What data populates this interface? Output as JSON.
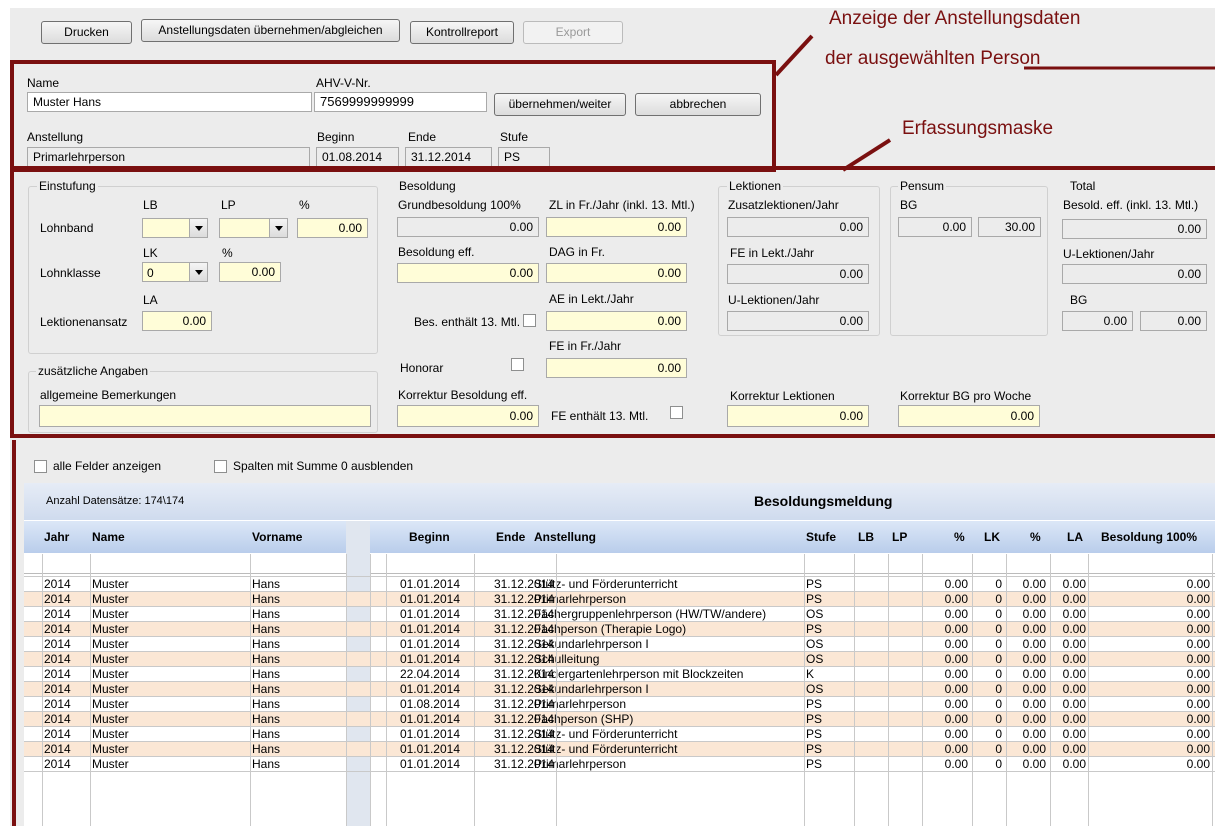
{
  "toolbar": {
    "print": "Drucken",
    "sync": "Anstellungsdaten übernehmen/abgleichen",
    "report": "Kontrollreport",
    "export": "Export"
  },
  "annotations": {
    "a1": "Anzeige der Anstellungsdaten",
    "a2": "der ausgewählten Person",
    "a3": "Erfassungsmaske"
  },
  "person": {
    "name_label": "Name",
    "name": "Muster Hans",
    "ahv_label": "AHV-V-Nr.",
    "ahv": "7569999999999",
    "accept_button": "übernehmen/weiter",
    "cancel_button": "abbrechen",
    "anstellung_label": "Anstellung",
    "anstellung": "Primarlehrperson",
    "beginn_label": "Beginn",
    "beginn": "01.08.2014",
    "ende_label": "Ende",
    "ende": "31.12.2014",
    "stufe_label": "Stufe",
    "stufe": "PS"
  },
  "einstufung": {
    "title": "Einstufung",
    "lb": "LB",
    "lp": "LP",
    "pct": "%",
    "lohnband": "Lohnband",
    "lohnband_pct": "0.00",
    "lk": "LK",
    "pct2": "%",
    "lohnklasse": "Lohnklasse",
    "lk_value": "0",
    "lk_pct": "0.00",
    "la": "LA",
    "lektionenansatz": "Lektionenansatz",
    "la_value": "0.00"
  },
  "zusatz": {
    "title": "zusätzliche Angaben",
    "bemerkungen": "allgemeine Bemerkungen"
  },
  "besoldung": {
    "title": "Besoldung",
    "grund_label": "Grundbesoldung 100%",
    "grund": "0.00",
    "zl_label": "ZL in Fr./Jahr (inkl. 13. Mtl.)",
    "zl": "0.00",
    "eff_label": "Besoldung eff.",
    "eff": "0.00",
    "dag_label": "DAG in Fr.",
    "dag": "0.00",
    "ae_label": "AE in Lekt./Jahr",
    "ae": "0.00",
    "bes13_label": "Bes. enthält 13. Mtl.",
    "fe_label": "FE in Fr./Jahr",
    "fe": "0.00",
    "honorar_label": "Honorar",
    "korr_label": "Korrektur Besoldung eff.",
    "korr": "0.00",
    "fe13_label": "FE enthält 13. Mtl."
  },
  "lektionen": {
    "title": "Lektionen",
    "zusatz_label": "Zusatzlektionen/Jahr",
    "zusatz": "0.00",
    "fe_label": "FE in Lekt./Jahr",
    "fe": "0.00",
    "u_label": "U-Lektionen/Jahr",
    "u": "0.00",
    "korr_label": "Korrektur Lektionen",
    "korr": "0.00"
  },
  "pensum": {
    "title": "Pensum",
    "bg_label": "BG",
    "bg1": "0.00",
    "bg2": "30.00",
    "korr_label": "Korrektur BG pro Woche",
    "korr": "0.00"
  },
  "total": {
    "title": "Total",
    "besold_label": "Besold. eff. (inkl. 13. Mtl.)",
    "besold": "0.00",
    "u_label": "U-Lektionen/Jahr",
    "u": "0.00",
    "bg_label": "BG",
    "bg1": "0.00",
    "bg2": "0.00"
  },
  "options": {
    "all_fields": "alle Felder anzeigen",
    "hide_zero": "Spalten mit Summe 0 ausblenden"
  },
  "grid": {
    "count": "Anzahl Datensätze: 174\\174",
    "title": "Besoldungsmeldung",
    "headers": [
      "Jahr",
      "Name",
      "Vorname",
      "Beginn",
      "Ende",
      "Anstellung",
      "Stufe",
      "LB",
      "LP",
      "%",
      "LK",
      "%",
      "LA",
      "Besoldung 100%"
    ],
    "rows": [
      [
        "2014",
        "Muster",
        "Hans",
        "01.01.2014",
        "31.12.2014",
        "Stütz- und Förderunterricht",
        "PS",
        "",
        "",
        "0.00",
        "0",
        "0.00",
        "0.00",
        "0.00"
      ],
      [
        "2014",
        "Muster",
        "Hans",
        "01.01.2014",
        "31.12.2014",
        "Primarlehrperson",
        "PS",
        "",
        "",
        "0.00",
        "0",
        "0.00",
        "0.00",
        "0.00"
      ],
      [
        "2014",
        "Muster",
        "Hans",
        "01.01.2014",
        "31.12.2014",
        "Fächergruppenlehrperson (HW/TW/andere)",
        "OS",
        "",
        "",
        "0.00",
        "0",
        "0.00",
        "0.00",
        "0.00"
      ],
      [
        "2014",
        "Muster",
        "Hans",
        "01.01.2014",
        "31.12.2014",
        "Fachperson (Therapie Logo)",
        "PS",
        "",
        "",
        "0.00",
        "0",
        "0.00",
        "0.00",
        "0.00"
      ],
      [
        "2014",
        "Muster",
        "Hans",
        "01.01.2014",
        "31.12.2014",
        "Sekundarlehrperson I",
        "OS",
        "",
        "",
        "0.00",
        "0",
        "0.00",
        "0.00",
        "0.00"
      ],
      [
        "2014",
        "Muster",
        "Hans",
        "01.01.2014",
        "31.12.2014",
        "Schulleitung",
        "OS",
        "",
        "",
        "0.00",
        "0",
        "0.00",
        "0.00",
        "0.00"
      ],
      [
        "2014",
        "Muster",
        "Hans",
        "22.04.2014",
        "31.12.2014",
        "Kindergartenlehrperson mit Blockzeiten",
        "K",
        "",
        "",
        "0.00",
        "0",
        "0.00",
        "0.00",
        "0.00"
      ],
      [
        "2014",
        "Muster",
        "Hans",
        "01.01.2014",
        "31.12.2014",
        "Sekundarlehrperson I",
        "OS",
        "",
        "",
        "0.00",
        "0",
        "0.00",
        "0.00",
        "0.00"
      ],
      [
        "2014",
        "Muster",
        "Hans",
        "01.08.2014",
        "31.12.2014",
        "Primarlehrperson",
        "PS",
        "",
        "",
        "0.00",
        "0",
        "0.00",
        "0.00",
        "0.00"
      ],
      [
        "2014",
        "Muster",
        "Hans",
        "01.01.2014",
        "31.12.2014",
        "Fachperson (SHP)",
        "PS",
        "",
        "",
        "0.00",
        "0",
        "0.00",
        "0.00",
        "0.00"
      ],
      [
        "2014",
        "Muster",
        "Hans",
        "01.01.2014",
        "31.12.2014",
        "Stütz- und Förderunterricht",
        "PS",
        "",
        "",
        "0.00",
        "0",
        "0.00",
        "0.00",
        "0.00"
      ],
      [
        "2014",
        "Muster",
        "Hans",
        "01.01.2014",
        "31.12.2014",
        "Stütz- und Förderunterricht",
        "PS",
        "",
        "",
        "0.00",
        "0",
        "0.00",
        "0.00",
        "0.00"
      ],
      [
        "2014",
        "Muster",
        "Hans",
        "01.01.2014",
        "31.12.2014",
        "Primarlehrperson",
        "PS",
        "",
        "",
        "0.00",
        "0",
        "0.00",
        "0.00",
        "0.00"
      ]
    ]
  }
}
